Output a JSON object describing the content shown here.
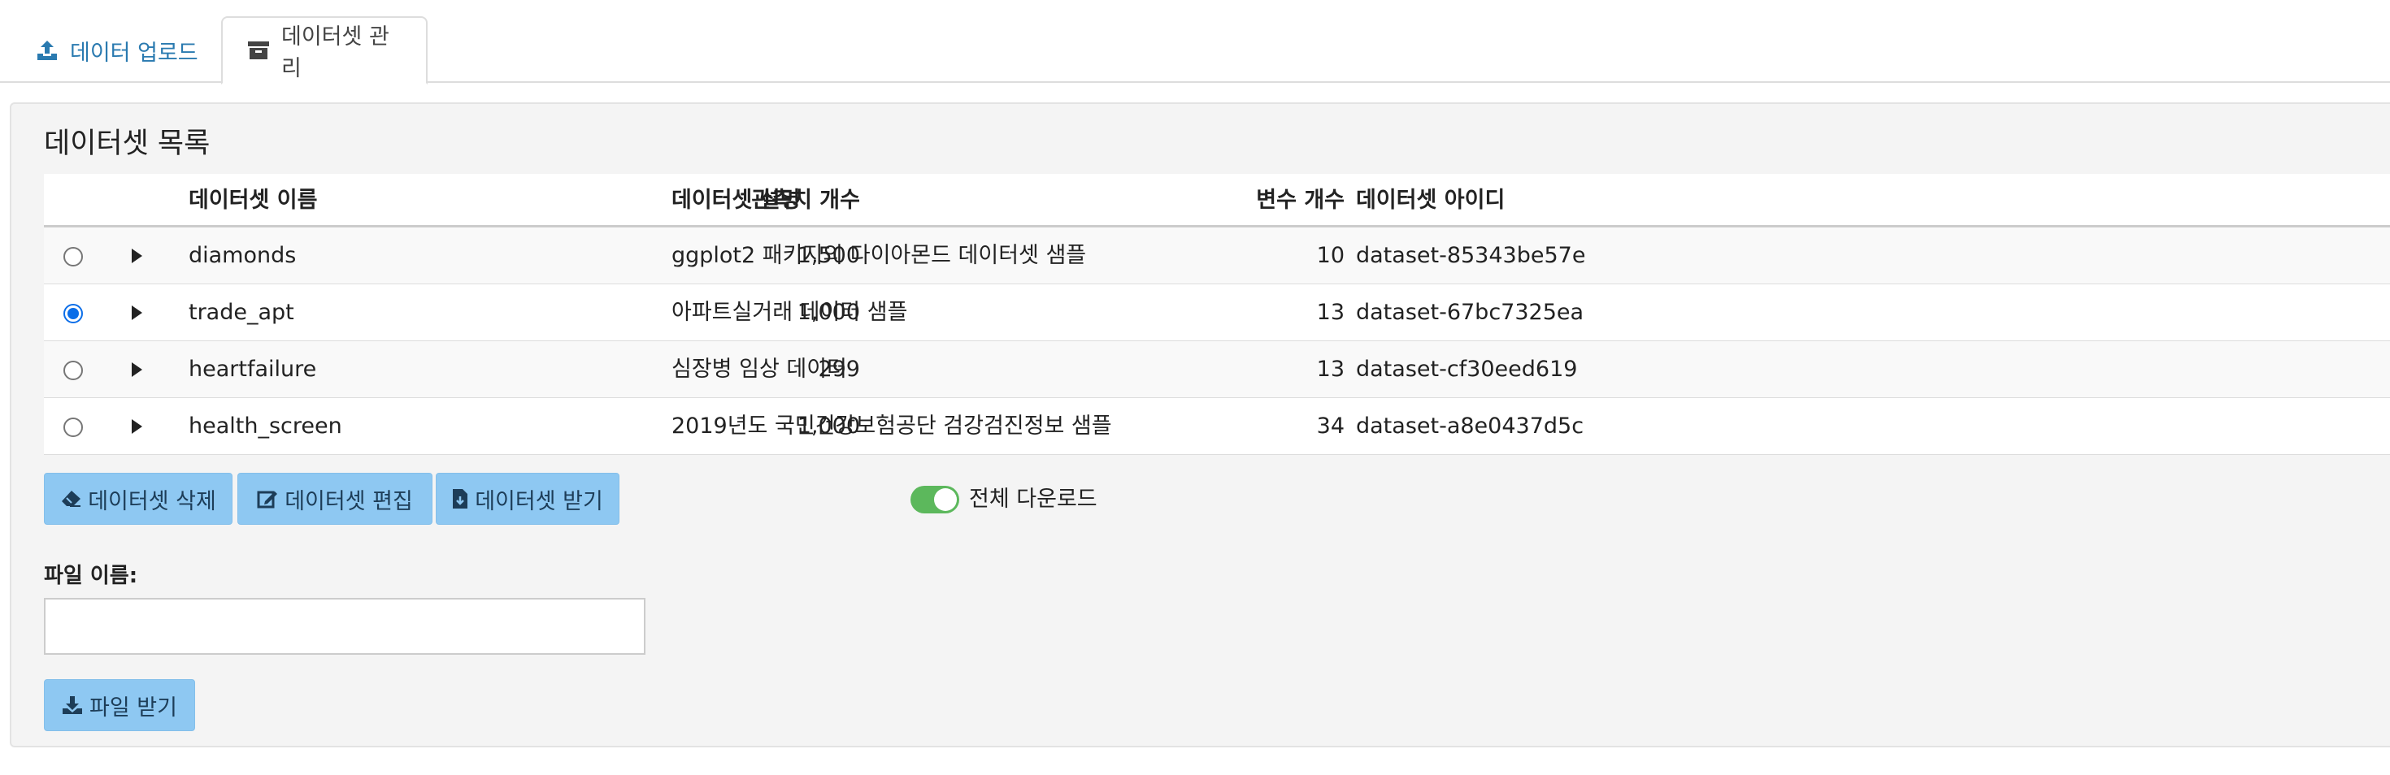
{
  "tabs": [
    {
      "label": "데이터 업로드",
      "icon": "upload-icon",
      "active": false
    },
    {
      "label": "데이터셋 관리",
      "icon": "archive-icon",
      "active": true
    }
  ],
  "panel": {
    "title": "데이터셋 목록"
  },
  "table": {
    "headers": {
      "name": "데이터셋 이름",
      "desc": "데이터셋 설명",
      "obs": "관측치 개수",
      "vars": "변수 개수",
      "id": "데이터셋 아이디"
    },
    "rows": [
      {
        "selected": false,
        "name": "diamonds",
        "desc": "ggplot2 패키지의 다이아몬드 데이터셋 샘플",
        "obs": "1,500",
        "vars": "10",
        "id": "dataset-85343be57e"
      },
      {
        "selected": true,
        "name": "trade_apt",
        "desc": "아파트실거래 데이터 샘플",
        "obs": "1,000",
        "vars": "13",
        "id": "dataset-67bc7325ea"
      },
      {
        "selected": false,
        "name": "heartfailure",
        "desc": "심장병 임상 데이터",
        "obs": "299",
        "vars": "13",
        "id": "dataset-cf30eed619"
      },
      {
        "selected": false,
        "name": "health_screen",
        "desc": "2019년도 국민건강보험공단 검강검진정보 샘플",
        "obs": "1,000",
        "vars": "34",
        "id": "dataset-a8e0437d5c"
      }
    ]
  },
  "buttons": {
    "delete": "데이터셋 삭제",
    "edit": "데이터셋 편집",
    "get": "데이터셋 받기",
    "file": "파일 받기"
  },
  "toggle": {
    "label": "전체 다운로드",
    "on": true,
    "color": "#5cb85c"
  },
  "file_field": {
    "label": "파일 이름:",
    "value": "",
    "placeholder": ""
  },
  "colors": {
    "accent_link": "#2a7ab0",
    "button_bg": "#8ec8f2",
    "radio_checked": "#0b6ee8"
  }
}
